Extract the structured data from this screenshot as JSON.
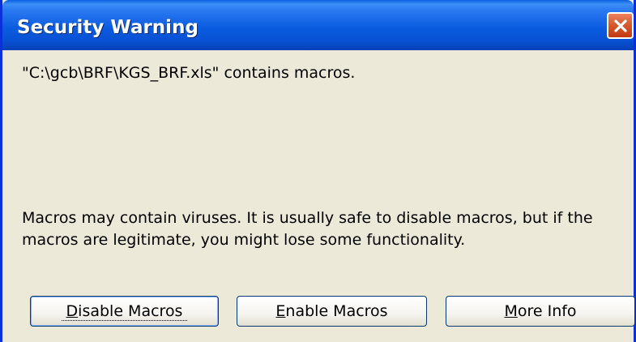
{
  "window": {
    "title": "Security Warning"
  },
  "message": "\"C:\\gcb\\BRF\\KGS_BRF.xls\" contains macros.",
  "description": "Macros may contain viruses. It is usually safe to disable macros, but if the macros are legitimate, you might lose some functionality.",
  "buttons": {
    "disable": {
      "mnemonic": "D",
      "rest": "isable Macros"
    },
    "enable": {
      "mnemonic": "E",
      "rest": "nable Macros"
    },
    "more": {
      "mnemonic": "M",
      "rest": "ore Info"
    }
  },
  "colors": {
    "titlebar": "#0b5ce0",
    "dialog_bg": "#ece9d8",
    "close_button": "#d95a2f"
  },
  "icons": [
    "close-icon"
  ]
}
